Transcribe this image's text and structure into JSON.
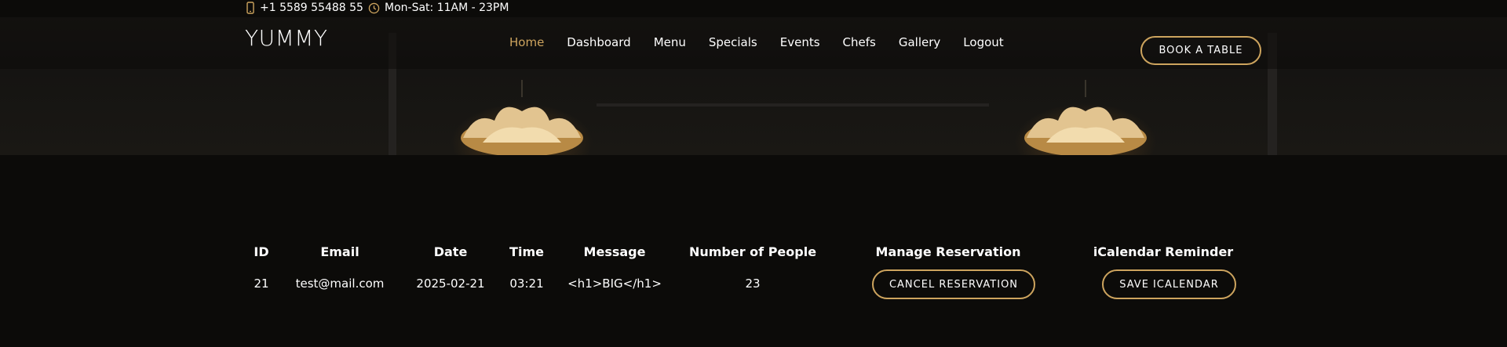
{
  "topbar": {
    "phone_icon": "phone-icon",
    "phone": "+1 5589 55488 55",
    "clock_icon": "clock-icon",
    "hours": "Mon-Sat: 11AM - 23PM"
  },
  "header": {
    "logo": "YUMMY",
    "nav": [
      "Home",
      "Dashboard",
      "Menu",
      "Specials",
      "Events",
      "Chefs",
      "Gallery",
      "Logout"
    ],
    "book_label": "BOOK A TABLE"
  },
  "table": {
    "headers": [
      "ID",
      "Email",
      "Date",
      "Time",
      "Message",
      "Number of People",
      "Manage Reservation",
      "iCalendar Reminder"
    ],
    "rows": [
      {
        "id": "21",
        "email": "test@mail.com",
        "date": "2025-02-21",
        "time": "03:21",
        "message": "<h1>BIG</h1>",
        "people": "23",
        "cancel_label": "CANCEL RESERVATION",
        "save_label": "SAVE ICALENDAR"
      }
    ]
  },
  "colors": {
    "accent": "#cda45e",
    "background": "#0c0b09"
  }
}
